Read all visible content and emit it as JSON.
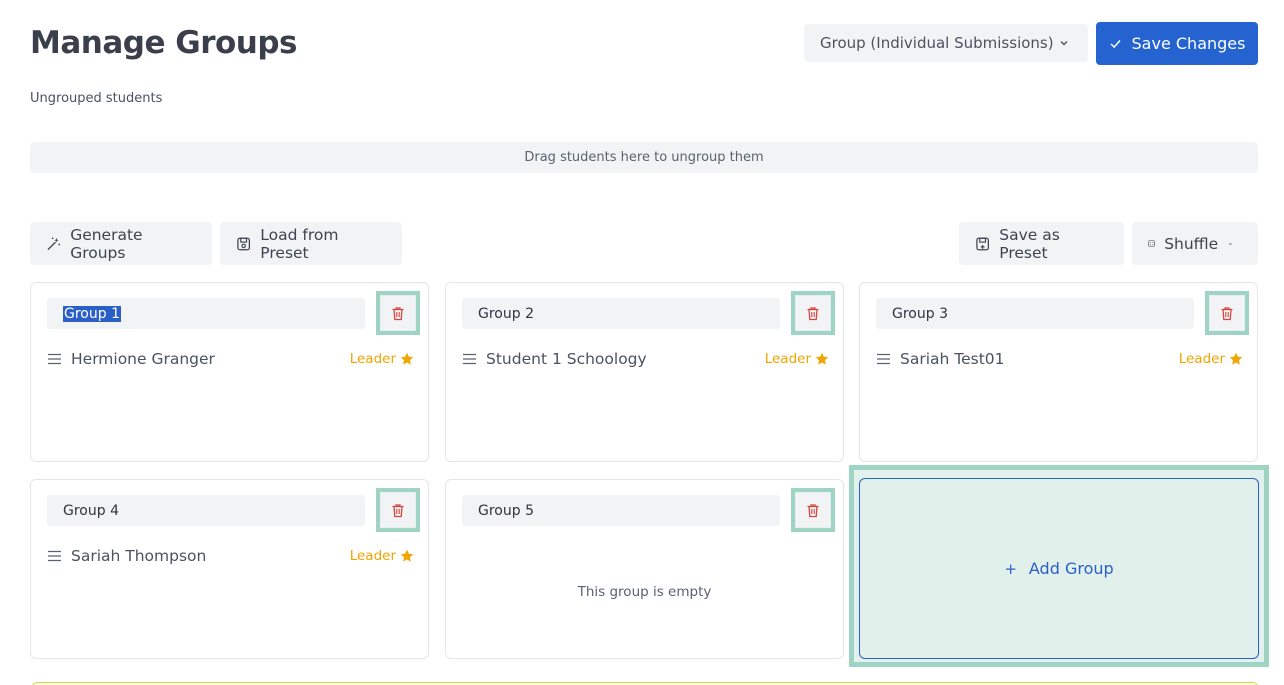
{
  "header": {
    "title": "Manage Groups",
    "mode_select": "Group (Individual Submissions)",
    "save_label": "Save Changes"
  },
  "ungrouped": {
    "label": "Ungrouped students",
    "dropzone_text": "Drag students here to ungroup them"
  },
  "toolbar": {
    "generate": "Generate Groups",
    "load_preset": "Load from Preset",
    "save_preset": "Save as Preset",
    "shuffle": "Shuffle"
  },
  "groups": [
    {
      "name": "Group 1",
      "members": [
        {
          "name": "Hermione Granger",
          "role": "Leader"
        }
      ]
    },
    {
      "name": "Group 2",
      "members": [
        {
          "name": "Student 1 Schoology",
          "role": "Leader"
        }
      ]
    },
    {
      "name": "Group 3",
      "members": [
        {
          "name": "Sariah Test01",
          "role": "Leader"
        }
      ]
    },
    {
      "name": "Group 4",
      "members": [
        {
          "name": "Sariah Thompson",
          "role": "Leader"
        }
      ]
    },
    {
      "name": "Group 5",
      "members": [],
      "empty_text": "This group is empty"
    }
  ],
  "add_group_label": "Add Group",
  "colors": {
    "primary": "#2563d0",
    "leader": "#f0a500",
    "delete_icon": "#d6453d",
    "highlight": "#9fd3c3"
  },
  "icons": {
    "select_chevron": "chevron-down-icon",
    "save_check": "check-icon",
    "generate": "magic-wand-icon",
    "load": "preset-load-icon",
    "save_preset": "preset-save-icon",
    "shuffle": "dice-icon",
    "delete": "trash-icon",
    "drag": "drag-handle-icon",
    "leader": "star-icon",
    "add": "plus-icon"
  }
}
